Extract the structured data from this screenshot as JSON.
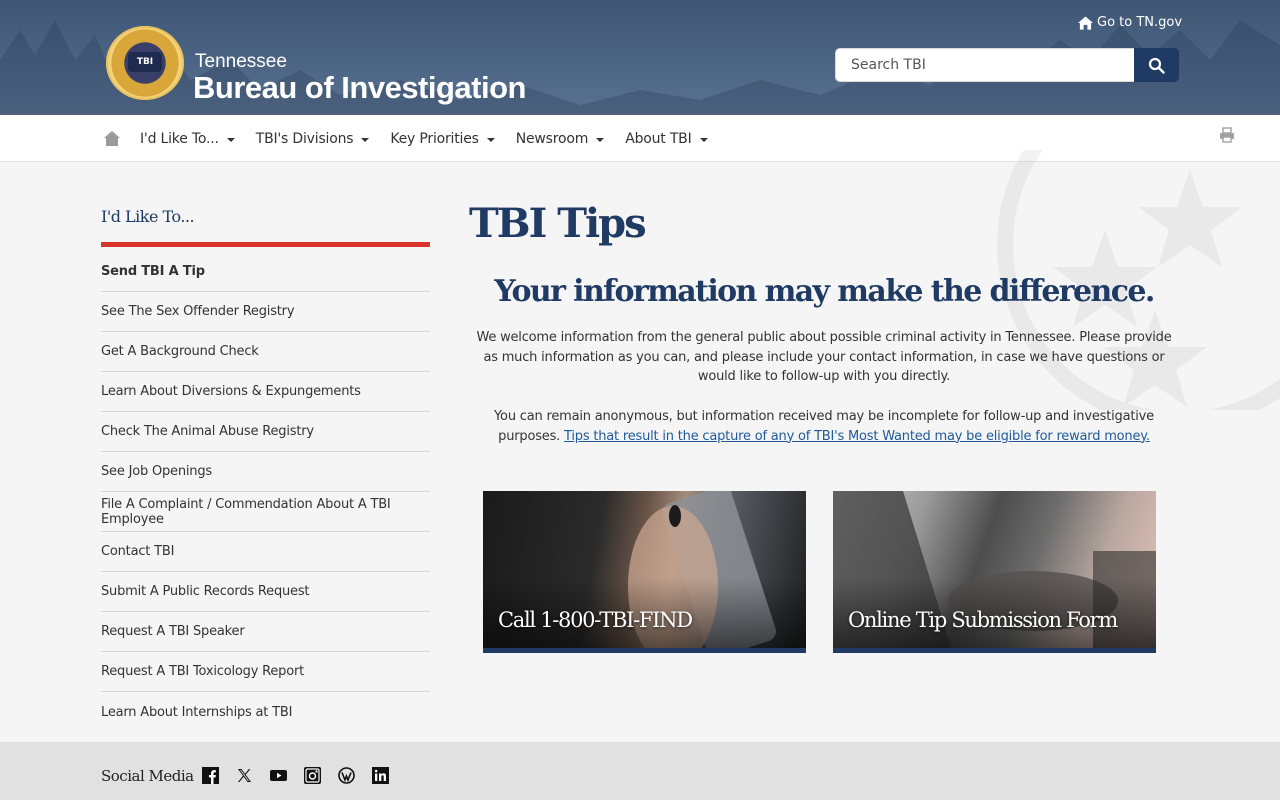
{
  "header": {
    "agency_small": "Tennessee",
    "agency_big": "Bureau of Investigation",
    "seal_text": "TBI",
    "go_tn": "Go to TN.gov",
    "search_placeholder": "Search TBI"
  },
  "nav": {
    "items": [
      {
        "label": "I'd Like To..."
      },
      {
        "label": "TBI's Divisions"
      },
      {
        "label": "Key Priorities"
      },
      {
        "label": "Newsroom"
      },
      {
        "label": "About TBI"
      }
    ]
  },
  "sidebar": {
    "title": "I'd Like To...",
    "items": [
      {
        "label": "Send TBI A Tip",
        "active": true
      },
      {
        "label": "See The Sex Offender Registry"
      },
      {
        "label": "Get A Background Check"
      },
      {
        "label": "Learn About Diversions & Expungements"
      },
      {
        "label": "Check The Animal Abuse Registry"
      },
      {
        "label": "See Job Openings"
      },
      {
        "label": "File A Complaint / Commendation About A TBI Employee"
      },
      {
        "label": "Contact TBI"
      },
      {
        "label": "Submit A Public Records Request"
      },
      {
        "label": "Request A TBI Speaker"
      },
      {
        "label": "Request A TBI Toxicology Report"
      },
      {
        "label": "Learn About Internships at TBI"
      }
    ]
  },
  "main": {
    "title": "TBI Tips",
    "subhead": "Your information may make the difference.",
    "para1": "We welcome information from the general public about possible criminal activity in Tennessee. Please provide as much information as you can, and please include your contact information, in case we have questions or would like to follow-up with you directly.",
    "para2": "You can remain anonymous, but information received may be incomplete for follow-up and investigative purposes.",
    "para2_link": "Tips that result in the capture of any of TBI's Most Wanted may be eligible for reward money.",
    "cards": [
      {
        "label": "Call 1-800-TBI-FIND"
      },
      {
        "label": "Online Tip Submission Form"
      }
    ]
  },
  "footer": {
    "social_title": "Social Media",
    "social_icons": [
      "facebook-icon",
      "x-icon",
      "youtube-icon",
      "instagram-icon",
      "wordpress-icon",
      "linkedin-icon"
    ]
  },
  "colors": {
    "brand_navy": "#1f3a63",
    "accent_red": "#d9352a",
    "header_blue": "#4d6585"
  }
}
